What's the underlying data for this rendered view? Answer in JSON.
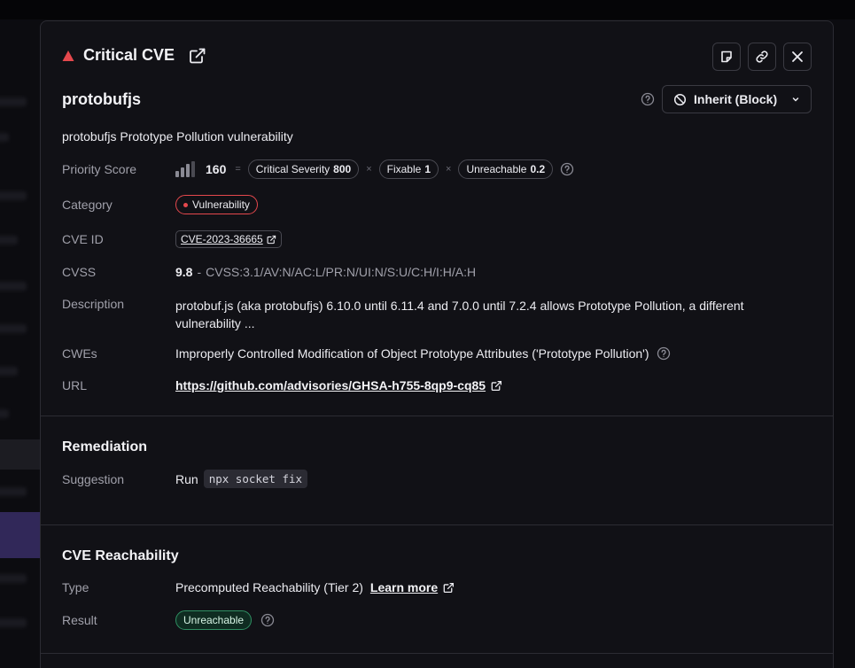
{
  "header": {
    "title": "Critical CVE"
  },
  "package": {
    "name": "protobufjs",
    "action_label": "Inherit (Block)"
  },
  "summary": "protobufjs Prototype Pollution vulnerability",
  "details": {
    "priority_score": {
      "label": "Priority Score",
      "value": "160",
      "equals": "=",
      "times": "×",
      "factors": [
        {
          "name": "Critical Severity",
          "value": "800"
        },
        {
          "name": "Fixable",
          "value": "1"
        },
        {
          "name": "Unreachable",
          "value": "0.2"
        }
      ]
    },
    "category": {
      "label": "Category",
      "value": "Vulnerability"
    },
    "cve_id": {
      "label": "CVE ID",
      "value": "CVE-2023-36665"
    },
    "cvss": {
      "label": "CVSS",
      "score": "9.8",
      "separator": "-",
      "vector": "CVSS:3.1/AV:N/AC:L/PR:N/UI:N/S:U/C:H/I:H/A:H"
    },
    "description": {
      "label": "Description",
      "value": "protobuf.js (aka protobufjs) 6.10.0 until 6.11.4 and 7.0.0 until 7.2.4 allows Prototype Pollution, a different vulnerability ..."
    },
    "cwes": {
      "label": "CWEs",
      "value": "Improperly Controlled Modification of Object Prototype Attributes ('Prototype Pollution')"
    },
    "url": {
      "label": "URL",
      "value": "https://github.com/advisories/GHSA-h755-8qp9-cq85"
    }
  },
  "remediation": {
    "title": "Remediation",
    "suggestion_label": "Suggestion",
    "suggestion_prefix": "Run",
    "command": "npx socket fix"
  },
  "reachability": {
    "title": "CVE Reachability",
    "type_label": "Type",
    "type_value": "Precomputed Reachability (Tier 2)",
    "learn_more": "Learn more",
    "result_label": "Result",
    "result_value": "Unreachable"
  },
  "colors": {
    "critical": "#e5484d",
    "reachable_ok": "#2f8f62",
    "panel_bg": "#111116"
  },
  "icons": [
    "warning-triangle-icon",
    "external-link-icon",
    "note-icon",
    "link-icon",
    "close-icon",
    "help-icon",
    "block-icon",
    "chevron-down-icon",
    "signal-bars-icon"
  ]
}
